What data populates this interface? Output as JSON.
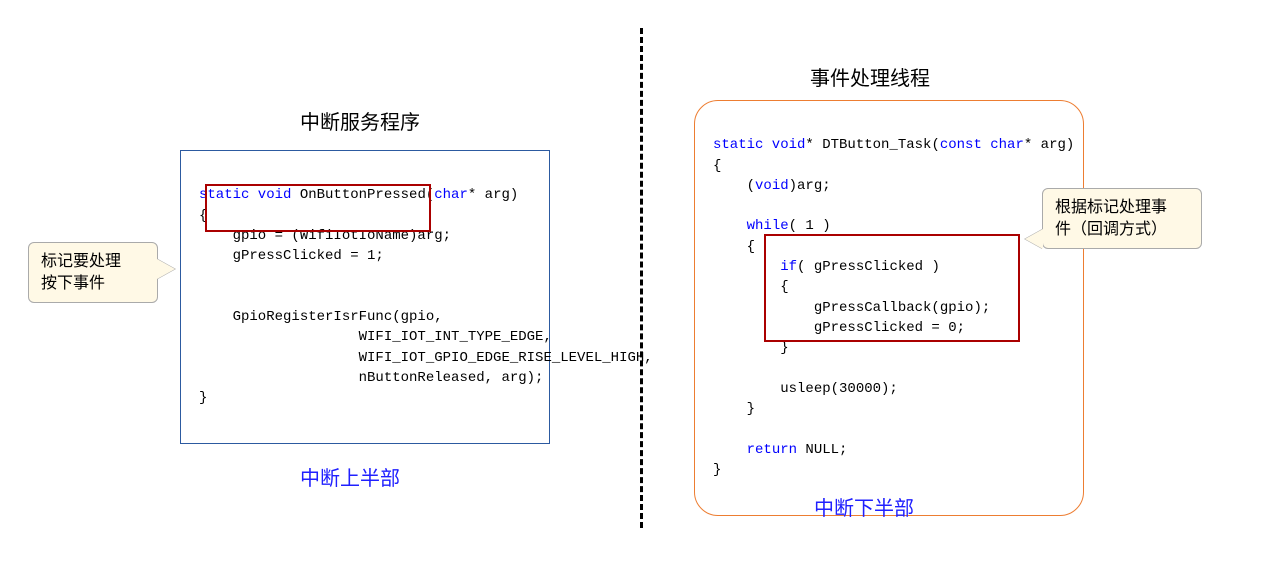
{
  "left": {
    "title": "中断服务程序",
    "caption": "中断上半部",
    "callout": "标记要处理\n按下事件",
    "code": {
      "p0": "static void",
      "p1": " OnButtonPressed(",
      "p2": "char",
      "p3": "* arg)",
      "l2": "{",
      "l3": "    gpio = (WifiIotIoName)arg;",
      "l4": "    gPressClicked = 1;",
      "l5": "",
      "l6": "",
      "l7": "    GpioRegisterIsrFunc(gpio,",
      "l8": "                   WIFI_IOT_INT_TYPE_EDGE,",
      "l9": "                   WIFI_IOT_GPIO_EDGE_RISE_LEVEL_HIGH,",
      "l10": "                   nButtonReleased, arg);",
      "l11": "}"
    }
  },
  "right": {
    "title": "事件处理线程",
    "caption": "中断下半部",
    "callout": "根据标记处理事\n件（回调方式）",
    "code": {
      "p0": "static void",
      "p1": "* DTButton_Task(",
      "p2": "const char",
      "p3": "* arg)",
      "l2": "{",
      "l3a": "    (",
      "l3b": "void",
      "l3c": ")arg;",
      "l4": "",
      "l5a": "    ",
      "l5b": "while",
      "l5c": "( 1 )",
      "l6": "    {",
      "l7a": "        ",
      "l7b": "if",
      "l7c": "( gPressClicked )",
      "l8": "        {",
      "l9": "            gPressCallback(gpio);",
      "l10": "            gPressClicked = 0;",
      "l11": "        }",
      "l12": "",
      "l13": "        usleep(30000);",
      "l14": "    }",
      "l15": "",
      "l16a": "    ",
      "l16b": "return",
      "l16c": " NULL;",
      "l17": "}"
    }
  }
}
